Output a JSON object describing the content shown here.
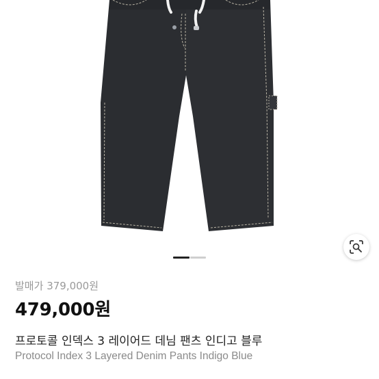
{
  "product": {
    "original_price_label": "발매가",
    "original_price": "379,000원",
    "sale_price": "479,000원",
    "title_ko": "프로토콜 인덱스 3 레이어드 데님 팬츠 인디고 블루",
    "title_en": "Protocol Index 3 Layered Denim Pants Indigo Blue"
  },
  "carousel": {
    "slide_count": 2,
    "active_index": 0
  },
  "icons": {
    "lens": "lens-search-icon"
  },
  "colors": {
    "denim": "#2b2d31",
    "stitch": "#b8b3a4",
    "price": "#111111",
    "muted": "#9a9a9a"
  }
}
